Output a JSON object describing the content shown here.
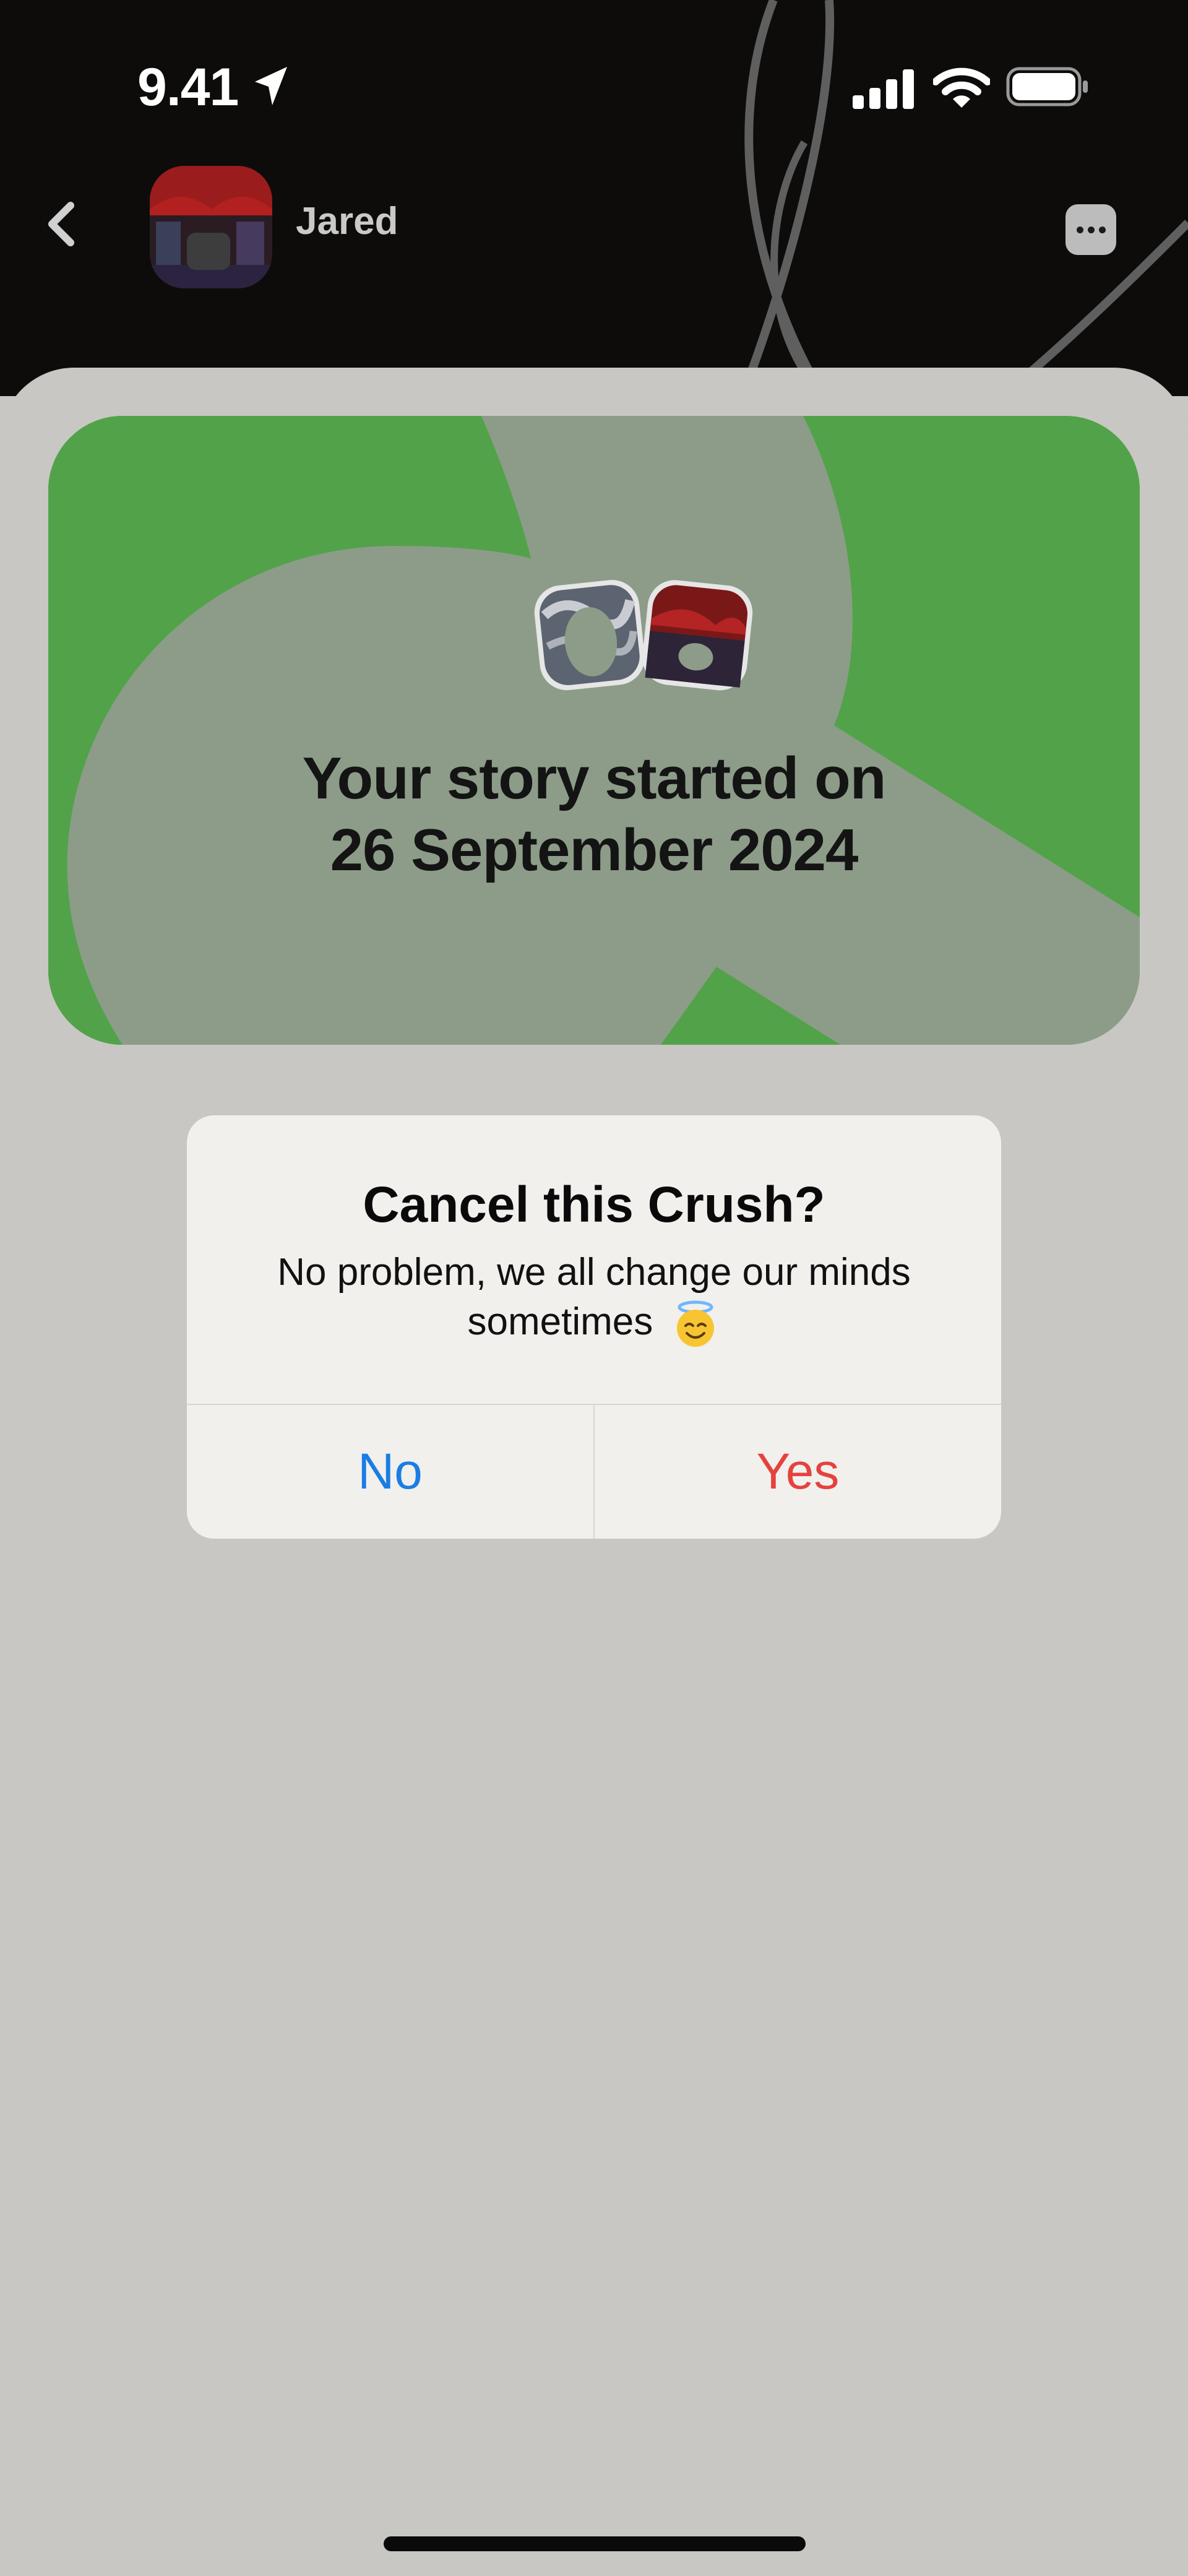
{
  "status_bar": {
    "time": "9.41",
    "icons": [
      "location-arrow-icon",
      "cellular-signal-icon",
      "wifi-icon",
      "battery-icon"
    ]
  },
  "header": {
    "back_icon": "chevron-left-icon",
    "contact_name": "Jared",
    "more_icon": "ellipsis-bubble-icon"
  },
  "story_card": {
    "title_line1": "Your story started on",
    "title_line2": "26 September 2024",
    "colors": {
      "green": "#52a24a",
      "gray": "#8c9c88"
    }
  },
  "dialog": {
    "title": "Cancel this Crush?",
    "message": "No problem, we all change our minds sometimes",
    "emoji_icon": "smiling-face-with-halo-icon",
    "no_label": "No",
    "yes_label": "Yes",
    "colors": {
      "no": "#1b7de3",
      "yes": "#e6423d"
    }
  }
}
